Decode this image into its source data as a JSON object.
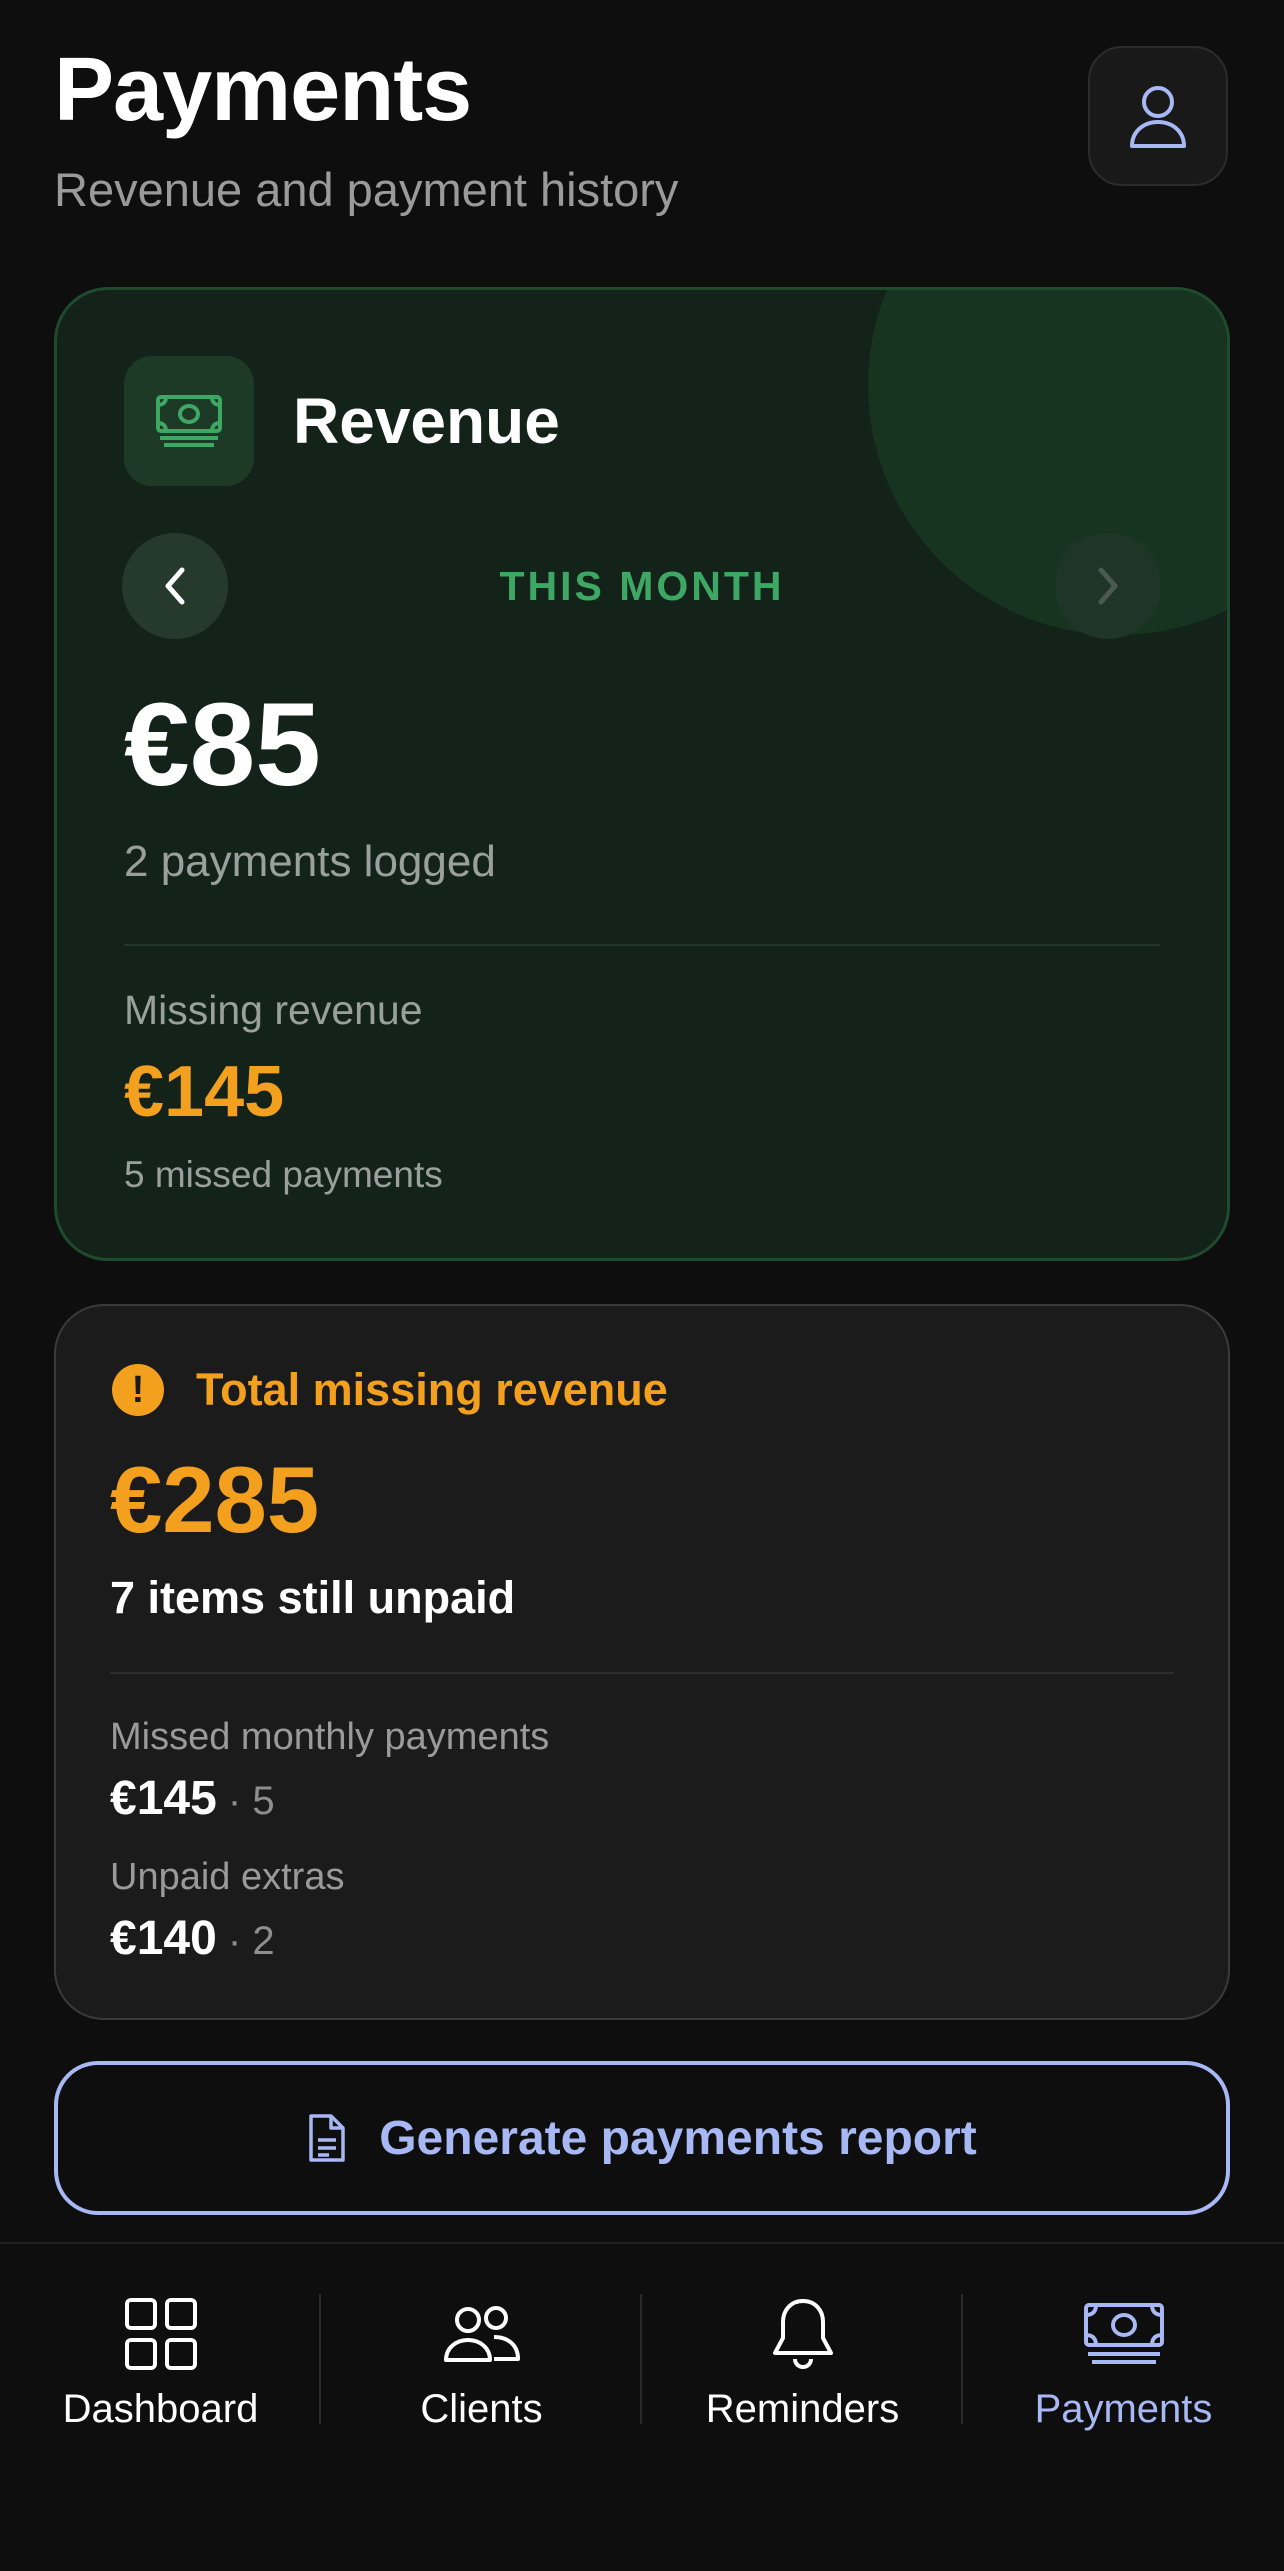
{
  "header": {
    "title": "Payments",
    "subtitle": "Revenue and payment history",
    "profile_icon": "user-icon"
  },
  "revenue_card": {
    "icon": "banknote-icon",
    "title": "Revenue",
    "period_label": "THIS MONTH",
    "prev_icon": "chevron-left-icon",
    "next_icon": "chevron-right-icon",
    "amount": "€85",
    "payments_logged": "2 payments logged",
    "missing_label": "Missing revenue",
    "missing_amount": "€145",
    "missed_count": "5 missed payments"
  },
  "total_missing": {
    "icon": "alert-circle-icon",
    "title": "Total missing revenue",
    "amount": "€285",
    "subtitle": "7 items still unpaid",
    "rows": [
      {
        "label": "Missed monthly payments",
        "amount": "€145",
        "count": "5"
      },
      {
        "label": "Unpaid extras",
        "amount": "€140",
        "count": "2"
      }
    ]
  },
  "report_button": {
    "icon": "document-icon",
    "label": "Generate payments report"
  },
  "tabbar": {
    "tabs": [
      {
        "label": "Dashboard",
        "icon": "grid-icon",
        "active": false
      },
      {
        "label": "Clients",
        "icon": "users-icon",
        "active": false
      },
      {
        "label": "Reminders",
        "icon": "bell-icon",
        "active": false
      },
      {
        "label": "Payments",
        "icon": "banknote-icon",
        "active": true
      }
    ]
  },
  "colors": {
    "background": "#0e0e0e",
    "accent": "#a7b8f5",
    "revenue_green": "#3da864",
    "warning_orange": "#f3a01e"
  }
}
